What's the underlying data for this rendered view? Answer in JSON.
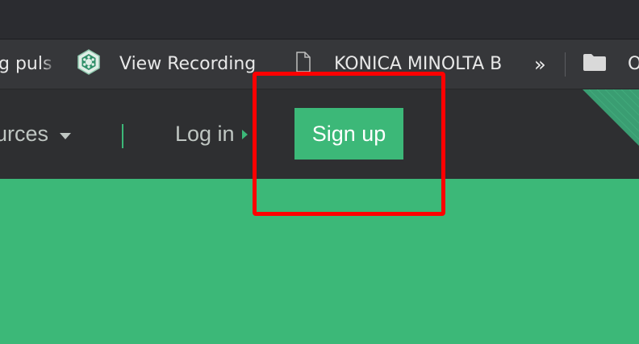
{
  "browser": {
    "bookmarks": [
      {
        "label": "g puls",
        "icon": "none"
      },
      {
        "label": "View Recording",
        "icon": "recording-badge-icon"
      },
      {
        "label": "KONICA MINOLTA B",
        "icon": "page-icon"
      },
      {
        "label": "O",
        "icon": "folder-icon"
      }
    ],
    "overflow_label": "»"
  },
  "site_nav": {
    "resources_label": "urces",
    "login_label": "Log in",
    "signup_label": "Sign up"
  },
  "colors": {
    "brand_green": "#3cb878",
    "header_bg": "#2e2f31",
    "nav_text": "#bfc6c2",
    "highlight": "#ff0000"
  }
}
